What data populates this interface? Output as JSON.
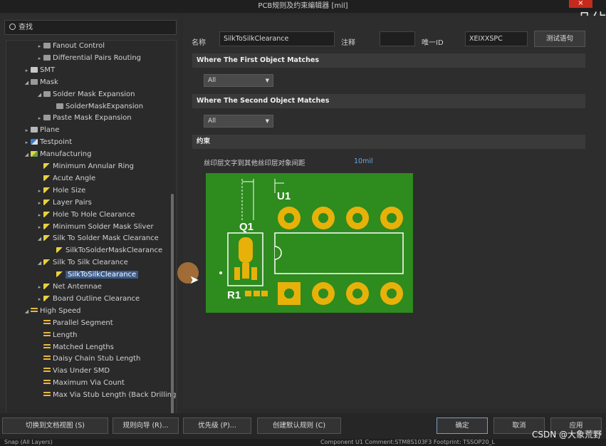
{
  "window": {
    "title": "PCB规则及约束编辑器 [mil]",
    "close_label": "×",
    "corner_logo": "凡佔"
  },
  "search": {
    "placeholder": "查找"
  },
  "tree": [
    {
      "label": "Fanout Control",
      "indent": 3,
      "arrow": "▸",
      "icon": "ic-gray"
    },
    {
      "label": "Differential Pairs Routing",
      "indent": 3,
      "arrow": "▸",
      "icon": "ic-gray"
    },
    {
      "label": "SMT",
      "indent": 2,
      "arrow": "▸",
      "icon": "ic-smt"
    },
    {
      "label": "Mask",
      "indent": 2,
      "arrow": "◢",
      "icon": "ic-gray"
    },
    {
      "label": "Solder Mask Expansion",
      "indent": 3,
      "arrow": "◢",
      "icon": "ic-gray"
    },
    {
      "label": "SolderMaskExpansion",
      "indent": 4,
      "arrow": "",
      "icon": "ic-gray"
    },
    {
      "label": "Paste Mask Expansion",
      "indent": 3,
      "arrow": "▸",
      "icon": "ic-gray"
    },
    {
      "label": "Plane",
      "indent": 2,
      "arrow": "▸",
      "icon": "ic-plane"
    },
    {
      "label": "Testpoint",
      "indent": 2,
      "arrow": "▸",
      "icon": "ic-test"
    },
    {
      "label": "Manufacturing",
      "indent": 2,
      "arrow": "◢",
      "icon": "ic-mfg"
    },
    {
      "label": "Minimum Annular Ring",
      "indent": 3,
      "arrow": "",
      "icon": "ic-rule"
    },
    {
      "label": "Acute Angle",
      "indent": 3,
      "arrow": "",
      "icon": "ic-rule"
    },
    {
      "label": "Hole Size",
      "indent": 3,
      "arrow": "▸",
      "icon": "ic-rule"
    },
    {
      "label": "Layer Pairs",
      "indent": 3,
      "arrow": "▸",
      "icon": "ic-rule"
    },
    {
      "label": "Hole To Hole Clearance",
      "indent": 3,
      "arrow": "▸",
      "icon": "ic-rule"
    },
    {
      "label": "Minimum Solder Mask Sliver",
      "indent": 3,
      "arrow": "▸",
      "icon": "ic-rule"
    },
    {
      "label": "Silk To Solder Mask Clearance",
      "indent": 3,
      "arrow": "◢",
      "icon": "ic-rule"
    },
    {
      "label": "SilkToSolderMaskClearance",
      "indent": 4,
      "arrow": "",
      "icon": "ic-rule"
    },
    {
      "label": "Silk To Silk Clearance",
      "indent": 3,
      "arrow": "◢",
      "icon": "ic-rule"
    },
    {
      "label": "SilkToSilkClearance",
      "indent": 4,
      "arrow": "",
      "icon": "ic-rule",
      "selected": true
    },
    {
      "label": "Net Antennae",
      "indent": 3,
      "arrow": "▸",
      "icon": "ic-rule"
    },
    {
      "label": "Board Outline Clearance",
      "indent": 3,
      "arrow": "▸",
      "icon": "ic-rule"
    },
    {
      "label": "High Speed",
      "indent": 2,
      "arrow": "◢",
      "icon": "ic-hs"
    },
    {
      "label": "Parallel Segment",
      "indent": 3,
      "arrow": "",
      "icon": "ic-hs"
    },
    {
      "label": "Length",
      "indent": 3,
      "arrow": "",
      "icon": "ic-hs"
    },
    {
      "label": "Matched Lengths",
      "indent": 3,
      "arrow": "",
      "icon": "ic-hs"
    },
    {
      "label": "Daisy Chain Stub Length",
      "indent": 3,
      "arrow": "",
      "icon": "ic-hs"
    },
    {
      "label": "Vias Under SMD",
      "indent": 3,
      "arrow": "",
      "icon": "ic-hs"
    },
    {
      "label": "Maximum Via Count",
      "indent": 3,
      "arrow": "",
      "icon": "ic-hs"
    },
    {
      "label": "Max Via Stub Length (Back Drilling)",
      "indent": 3,
      "arrow": "",
      "icon": "ic-hs"
    }
  ],
  "rule": {
    "name_label": "名称",
    "name_value": "SilkToSilkClearance",
    "comment_label": "注释",
    "comment_value": "",
    "id_label": "唯一ID",
    "id_value": "XEIXXSPC",
    "test_button": "测试语句"
  },
  "first_match": {
    "header": "Where The First Object Matches",
    "value": "All"
  },
  "second_match": {
    "header": "Where The Second Object Matches",
    "value": "All"
  },
  "constraints": {
    "header": "约束",
    "clearance_label": "丝印层文字到其他丝印层对象间距",
    "clearance_value": "10mil",
    "label_u1": "U1",
    "label_q1": "Q1",
    "label_r1": "R1"
  },
  "colors": {
    "pcb_green": "#2e8b1e",
    "pad_yellow": "#e8b10a",
    "selection": "#3a5a8a"
  },
  "bottom": {
    "switch_doc_view": "切换到文档视图 (S)",
    "rule_wizard": "规则向导 (R)...",
    "priority": "优先级 (P)...",
    "create_default": "创建默认规则 (C)",
    "ok": "确定",
    "cancel": "取消",
    "apply": "应用"
  },
  "status": {
    "left": "Snap (All Layers)",
    "right": "Component U1 Comment:STM8S103F3 Footprint: TSSOP20_L"
  },
  "watermark": "CSDN @大象荒野"
}
